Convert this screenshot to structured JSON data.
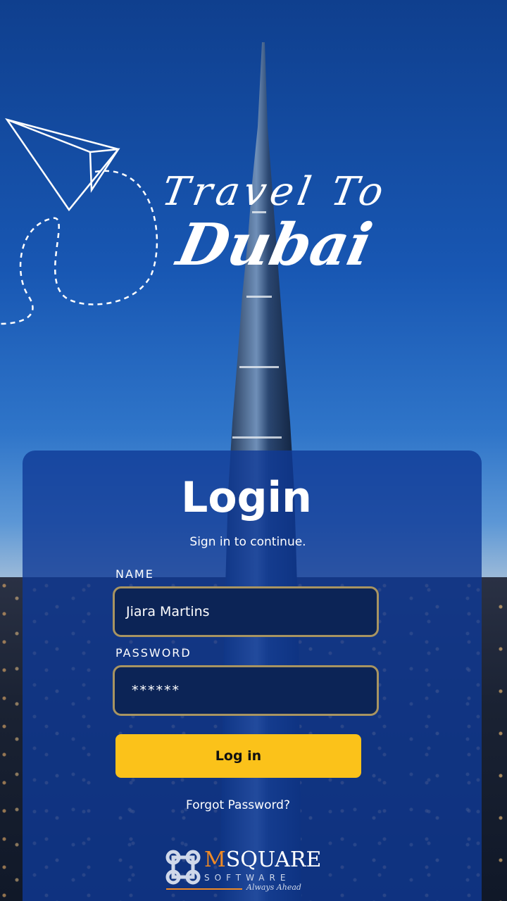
{
  "hero": {
    "title_line1": "Travel To",
    "title_line2": "Dubai"
  },
  "login": {
    "title": "Login",
    "subtitle": "Sign in to continue.",
    "name_label": "NAME",
    "name_value": "Jiara Martins",
    "password_label": "PASSWORD",
    "password_value": "******",
    "button_label": "Log in",
    "forgot_label": "Forgot Password?"
  },
  "footer": {
    "logo_top_prefix": "M",
    "logo_top_rest": "SQUARE",
    "logo_sub": "SOFTWARE",
    "logo_tag": "Always Ahead"
  },
  "colors": {
    "button": "#fbc21a",
    "card": "#0f3a96",
    "input_border": "#a89461",
    "logo_accent": "#f08a24"
  },
  "icons": [
    "paper-plane-icon",
    "msquare-logo-icon"
  ]
}
